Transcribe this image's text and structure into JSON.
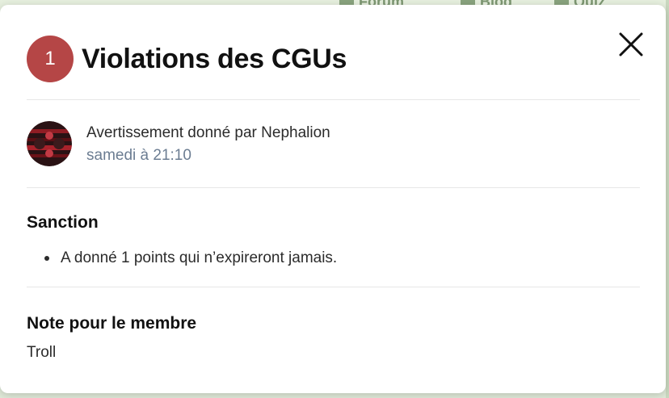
{
  "background": {
    "nav": [
      {
        "label": "Forum",
        "icon": "forum-icon"
      },
      {
        "label": "Blog",
        "icon": "blog-icon"
      },
      {
        "label": "Quiz",
        "icon": "quiz-icon"
      }
    ]
  },
  "modal": {
    "badge": "1",
    "title": "Violations des CGUs",
    "close_icon": "close-icon",
    "warning": {
      "given_by": "Avertissement donné par Nephalion",
      "date": "samedi à 21:10",
      "avatar": "avatar"
    },
    "sanction": {
      "heading": "Sanction",
      "items": [
        "A donné 1 points qui n’expireront jamais."
      ]
    },
    "note": {
      "heading": "Note pour le membre",
      "text": "Troll"
    },
    "colors": {
      "badge": "#b54646",
      "date": "#6c7d92"
    }
  }
}
